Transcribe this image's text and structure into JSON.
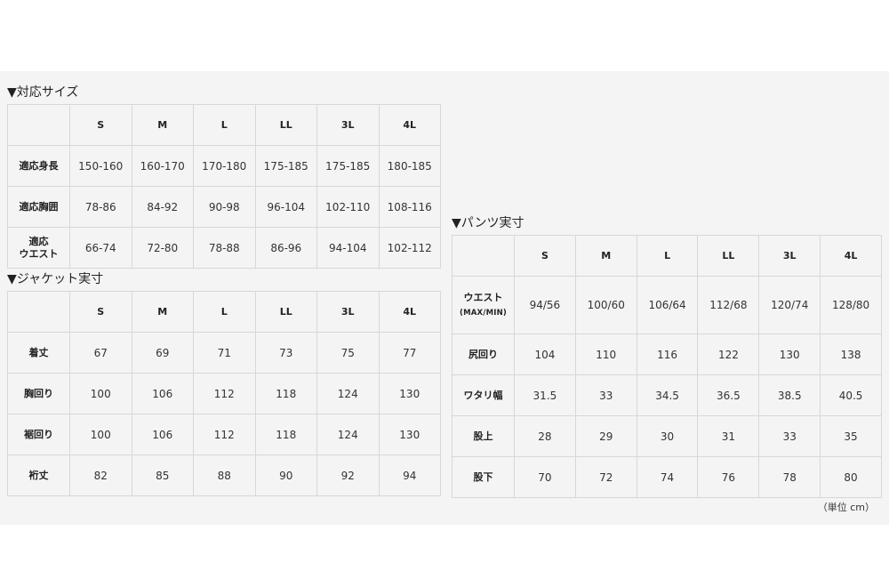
{
  "size_table": {
    "title": "▼対応サイズ",
    "headers": [
      "",
      "S",
      "M",
      "L",
      "LL",
      "3L",
      "4L"
    ],
    "rows": [
      {
        "label": "適応身長",
        "values": [
          "150-160",
          "160-170",
          "170-180",
          "175-185",
          "175-185",
          "180-185"
        ]
      },
      {
        "label": "適応胸囲",
        "values": [
          "78-86",
          "84-92",
          "90-98",
          "96-104",
          "102-110",
          "108-116"
        ]
      },
      {
        "label": "適応\nウエスト",
        "values": [
          "66-74",
          "72-80",
          "78-88",
          "86-96",
          "94-104",
          "102-112"
        ]
      }
    ]
  },
  "jacket_table": {
    "title": "▼ジャケット実寸",
    "headers": [
      "",
      "S",
      "M",
      "L",
      "LL",
      "3L",
      "4L"
    ],
    "rows": [
      {
        "label": "着丈",
        "values": [
          "67",
          "69",
          "71",
          "73",
          "75",
          "77"
        ]
      },
      {
        "label": "胸回り",
        "values": [
          "100",
          "106",
          "112",
          "118",
          "124",
          "130"
        ]
      },
      {
        "label": "裾回り",
        "values": [
          "100",
          "106",
          "112",
          "118",
          "124",
          "130"
        ]
      },
      {
        "label": "裄丈",
        "values": [
          "82",
          "85",
          "88",
          "90",
          "92",
          "94"
        ]
      }
    ]
  },
  "pants_table": {
    "title": "▼パンツ実寸",
    "headers": [
      "",
      "S",
      "M",
      "L",
      "LL",
      "3L",
      "4L"
    ],
    "rows": [
      {
        "label": "ウエスト",
        "sub": "(MAX/MIN)",
        "values": [
          "94/56",
          "100/60",
          "106/64",
          "112/68",
          "120/74",
          "128/80"
        ]
      },
      {
        "label": "尻回り",
        "values": [
          "104",
          "110",
          "116",
          "122",
          "130",
          "138"
        ]
      },
      {
        "label": "ワタリ幅",
        "values": [
          "31.5",
          "33",
          "34.5",
          "36.5",
          "38.5",
          "40.5"
        ]
      },
      {
        "label": "股上",
        "values": [
          "28",
          "29",
          "30",
          "31",
          "33",
          "35"
        ]
      },
      {
        "label": "股下",
        "values": [
          "70",
          "72",
          "74",
          "76",
          "78",
          "80"
        ]
      }
    ]
  },
  "unit_note": "（単位 cm）"
}
